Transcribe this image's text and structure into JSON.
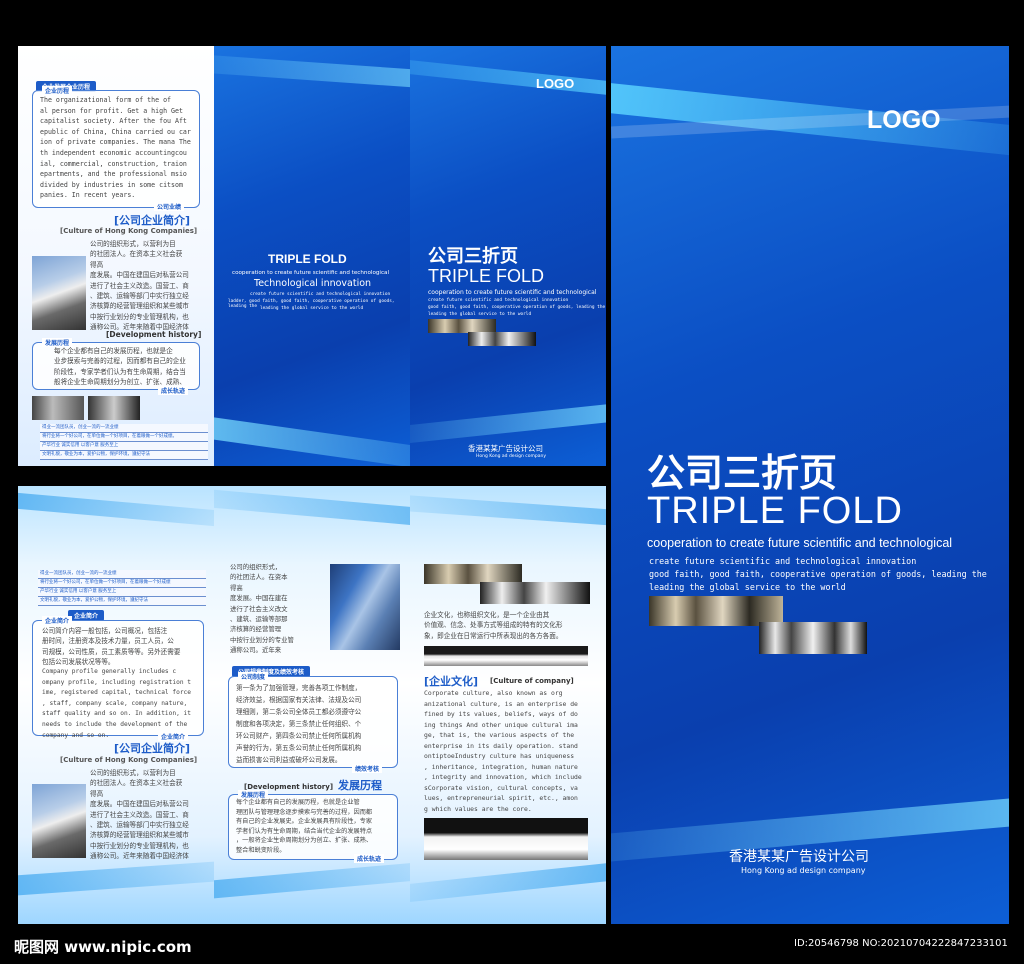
{
  "colors": {
    "brand_blue": "#0b4fc4",
    "accent_cyan": "#7dd6ff",
    "heading_blue": "#1d5cc8"
  },
  "right": {
    "logo": "LOGO",
    "title_cn": "公司三折页",
    "title_en": "TRIPLE FOLD",
    "line1": "cooperation to create future scientific and technological",
    "line2": "create future scientific and technological innovation",
    "line3": "good faith, good faith, cooperative operation of goods, leading the",
    "line4": "leading the global service to the world",
    "company_cn": "香港某某广告设计公司",
    "company_en": "Hong Kong ad design company"
  },
  "top_mid": {
    "title": "TRIPLE FOLD",
    "sub1": "cooperation to create future scientific and technological",
    "sub2": "Technological innovation",
    "sub3": "create future scientific and technological innovation",
    "sub4": "ladder, good faith, good faith, cooperative operation of goods, leading the",
    "sub5": "leading the global service to the world"
  },
  "top_right": {
    "logo": "LOGO",
    "title_cn": "公司三折页",
    "title_en": "TRIPLE FOLD",
    "line1": "cooperation to create future scientific and technological",
    "line2": "create future scientific and technological innovation",
    "line3": "good faith, good faith, cooperative operation of goods, leading the",
    "line4": "leading the global service to the world",
    "company_cn": "香港某某广告设计公司",
    "company_en": "Hong Kong ad design company"
  },
  "top_left": {
    "header": "企业发展企业历程",
    "tag1": "企业历程",
    "para1": [
      "The organizational form of the of",
      "al person for profit. Get a high Get",
      "capitalist society. After the fou Aft",
      "epublic of China, China carried ou car",
      "ion of private companies. The mana The",
      "th independent economic accountingcou",
      "ial, commercial, construction, traion",
      "epartments, and the professional msio",
      " divided by industries in some citsom",
      "panies. In recent years."
    ],
    "tag1b": "公司业绩",
    "sec_cn": "[公司企业简介]",
    "sec_en": "[Culture of Hong Kong Companies]",
    "para2": [
      "公司的组织形式，以营利为目",
      "的社团法人。在资本主义社会获",
      "得高",
      "度发展。中国在建国后对私营公司",
      "进行了社会主义改造。国营工、商",
      "、建筑、运输等部门中实行独立经",
      "济核算的经营管理组织和某些城市",
      "中按行业划分的专业管理机构，也",
      "通称公司。近年来随着中国经济体"
    ],
    "dev_en": "[Development history]",
    "tag2": "发展历程",
    "para3": [
      "每个企业都有自己的发展历程，也就是企",
      "业步摸索与完善的过程，因而都有自己的企业",
      "阶段性，专家学者们认为有生命周期，结合当",
      "般将企业生命周期划分为创立、扩张、成熟、"
    ],
    "tag2b": "成长轨迹",
    "list": [
      "得业一流团队员，创业一流的一流业绩",
      "将行业将一个好公司，在单位做一个好项目，在着眼做一个好成绩。",
      "产华行业  诚实信用  以客户意  服务至上",
      "文明礼貌，敬业为本，爱护公物，保护环境，遵纪守法"
    ]
  },
  "bottom_left": {
    "list": [
      "得业一流团队员，创业一流的一流业绩",
      "将行业将一个好公司，在单位做一个好项目，在着眼做一个好成绩",
      "产华行业  诚实信用  以客户意  服务至上",
      "文明礼貌，敬业为本，爱护公物，保护环境，遵纪守法"
    ],
    "header": "企业简介",
    "tag1": "企业简介",
    "para1": [
      "公司简介内容一般包括，公司概况，包括注",
      "册时间，注册资本及技术力量，员工人员，公",
      "司规模，公司性质，员工素质等等。另外还需要",
      "包括公司发展状况等等。"
    ],
    "para1en": [
      "Company profile generally includes c",
      "ompany profile, including registration t",
      "ime, registered capital, technical force",
      ", staff, company scale, company nature,",
      "staff quality and so on. In addition, it",
      " needs to include the development of the",
      " company and so on."
    ],
    "tag1b": "企业简介",
    "sec_cn": "[公司企业简介]",
    "sec_en": "[Culture of Hong Kong Companies]",
    "para2": [
      "公司的组织形式，以营利为目",
      "的社团法人。在资本主义社会获",
      "得高",
      "度发展。中国在建国后对私营公司",
      "进行了社会主义改造。国营工、商",
      "、建筑、运输等部门中实行独立经",
      "济核算的经营管理组织和某些城市",
      "中按行业划分的专业管理机构，也",
      "通称公司。近年来随着中国经济体"
    ]
  },
  "bottom_mid": {
    "para1": [
      "公司的组织形式，",
      "的社团法人。在资本",
      "得高",
      "度发展。中国在建在",
      "进行了社会主义改文",
      "、建筑、运输等部那",
      "济核算的经营管理",
      "中按行业划分的专业管",
      "通称公司。近年来"
    ],
    "header": "公司规章制度及绩效考核",
    "tag1": "公司制度",
    "para2": [
      "第一条为了加强管理，完善各项工作制度，",
      "经济效益，根据国家有关法律、法规及公司",
      "理细则，第二条公司全体员工都必须遵守公",
      "制度和各项决定，第三条禁止任何组织、个",
      "环公司财产，第四条公司禁止任何所属机构",
      "声誉的行为，第五条公司禁止任何所属机构",
      "益而损害公司利益或破坏公司发展。"
    ],
    "tag1b": "绩效考核",
    "dev_en": "[Development history]",
    "dev_cn": "发展历程",
    "tag2": "发展历程",
    "para3": [
      "每个企业都有自己的发展历程，也就是企业管",
      "理团队与管理理念逐步摸索与完善的过程，因而都",
      "有自己的企业发展史。企业发展具有阶段性，专家",
      "学者们认为有生命周期，结合当代企业的发展特点",
      "，一般将企业生命周期划分为创立、扩张、成熟、",
      "整合和蜕变阶段。"
    ],
    "tag2b": "成长轨迹"
  },
  "bottom_right": {
    "para1": [
      "企业文化，也称组织文化，是一个企业由其",
      "价值观、信念、处事方式等组成的特有的文化形",
      "象，即企业在日常运行中所表现出的各方各面。"
    ],
    "sec_cn": "[企业文化]",
    "sec_en": "[Culture of company]",
    "para2": [
      "Corporate culture, also known as org",
      "anizational culture, is an enterprise de",
      "fined by its values, beliefs, ways of do",
      "ing things And other unique cultural ima",
      "ge, that is, the various aspects of the",
      "enterprise in its daily operation. stand",
      "ontiptoeIndustry culture has uniqueness",
      ", inheritance, integration, human nature",
      ", integrity and innovation, which include",
      "sCorporate vision, cultural concepts, va",
      "lues, entrepreneurial spirit, etc., amon",
      "g which values are the core."
    ]
  },
  "watermark": {
    "site": "昵图网 www.nipic.com",
    "id": "ID:20546798 NO:20210704222847233101"
  }
}
